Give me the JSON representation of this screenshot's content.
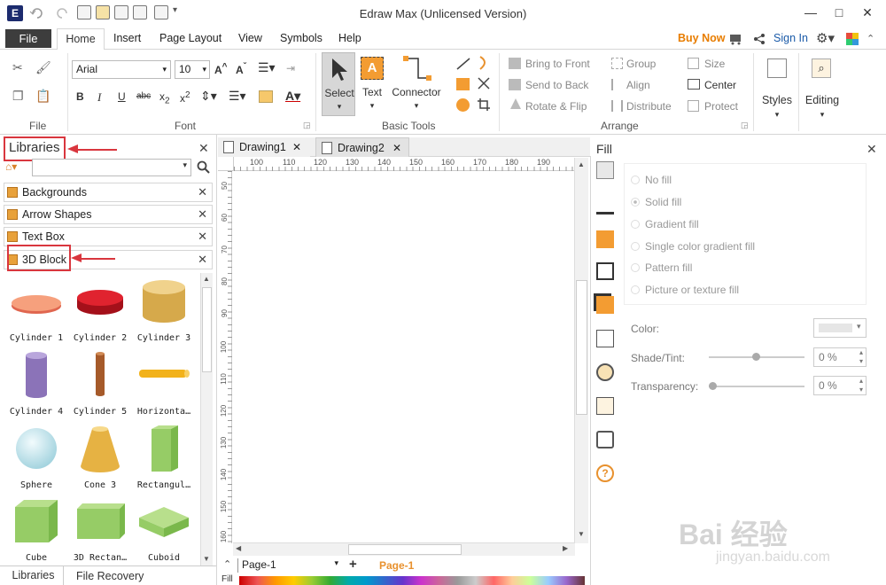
{
  "app": {
    "title": "Edraw Max (Unlicensed Version)",
    "logo": "E"
  },
  "window": {
    "minimize": "—",
    "maximize": "□",
    "close": "✕"
  },
  "menu": {
    "file": "File",
    "tabs": [
      "Home",
      "Insert",
      "Page Layout",
      "View",
      "Symbols",
      "Help"
    ],
    "buy_now": "Buy Now",
    "sign_in": "Sign In"
  },
  "ribbon": {
    "font": {
      "family": "Arial",
      "size": "10",
      "group_label": "Font"
    },
    "file_group_label": "File",
    "basic_tools": {
      "select": "Select",
      "text": "Text",
      "connector": "Connector",
      "group_label": "Basic Tools"
    },
    "arrange": {
      "bring_to_front": "Bring to Front",
      "send_to_back": "Send to Back",
      "rotate_flip": "Rotate & Flip",
      "group": "Group",
      "align": "Align",
      "distribute": "Distribute",
      "size": "Size",
      "center": "Center",
      "protect": "Protect",
      "group_label": "Arrange"
    },
    "styles": "Styles",
    "editing": "Editing"
  },
  "libraries": {
    "title": "Libraries",
    "categories": [
      "Backgrounds",
      "Arrow Shapes",
      "Text Box",
      "3D Block"
    ],
    "shapes": [
      "Cylinder 1",
      "Cylinder 2",
      "Cylinder 3",
      "Cylinder 4",
      "Cylinder 5",
      "Horizonta…",
      "Sphere",
      "Cone 3",
      "Rectangul…",
      "Cube",
      "3D Rectan…",
      "Cuboid"
    ],
    "bottom_tabs": [
      "Libraries",
      "File Recovery"
    ]
  },
  "documents": {
    "tabs": [
      "Drawing1",
      "Drawing2"
    ],
    "active": "Drawing2"
  },
  "ruler": {
    "h": [
      "100",
      "110",
      "120",
      "130",
      "140",
      "150",
      "160",
      "170",
      "180",
      "190"
    ],
    "v": [
      "50",
      "60",
      "70",
      "80",
      "90",
      "100",
      "110",
      "120",
      "130",
      "140",
      "150",
      "160"
    ]
  },
  "pages": {
    "current": "Page-1",
    "tab": "Page-1",
    "fill_label": "Fill"
  },
  "fill_panel": {
    "title": "Fill",
    "options": [
      "No fill",
      "Solid fill",
      "Gradient fill",
      "Single color gradient fill",
      "Pattern fill",
      "Picture or texture fill"
    ],
    "color_label": "Color:",
    "shade_label": "Shade/Tint:",
    "shade_value": "0 %",
    "transparency_label": "Transparency:",
    "transparency_value": "0 %"
  },
  "watermark": {
    "brand": "Bai 经验",
    "url": "jingyan.baidu.com"
  }
}
